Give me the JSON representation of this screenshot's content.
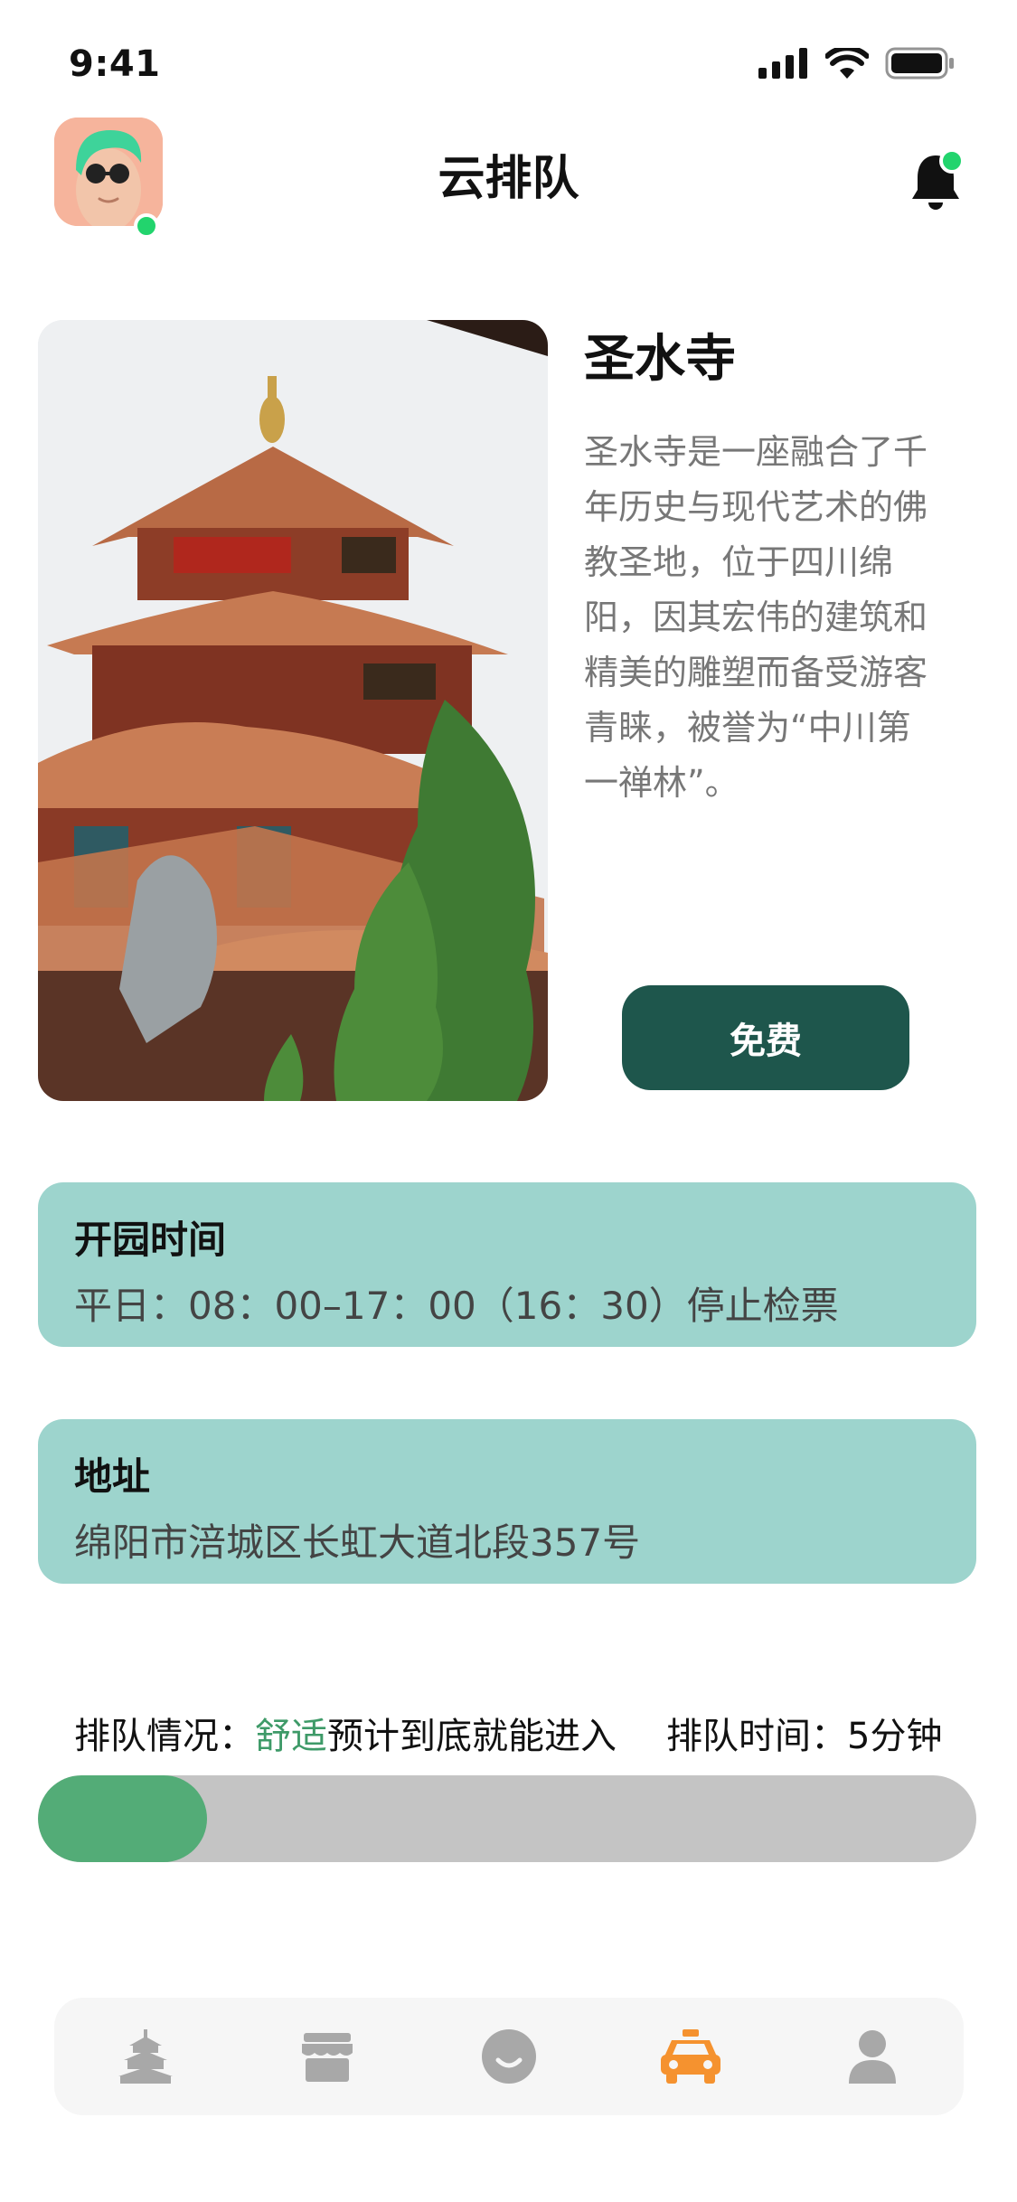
{
  "status_bar": {
    "time": "9:41",
    "signal_icon": "signal-icon",
    "wifi_icon": "wifi-icon",
    "battery_icon": "battery-icon"
  },
  "header": {
    "title": "云排队",
    "avatar_icon": "avatar",
    "online_dot_color": "#22d46d",
    "notification_icon": "bell-icon",
    "notification_dot_color": "#22d46d"
  },
  "attraction": {
    "name": "圣水寺",
    "description": "圣水寺是一座融合了千年历史与现代艺术的佛教圣地，位于四川绵阳，因其宏伟的建筑和精美的雕塑而备受游客青睐，被誉为“中川第一禅林”。",
    "price_label": "免费",
    "button_color": "#1e564c"
  },
  "hours": {
    "title": "开园时间",
    "value": "平日：08：00–17：00（16：30）停止检票"
  },
  "address": {
    "title": "地址",
    "value": "绵阳市涪城区长虹大道北段357号"
  },
  "queue": {
    "label": "排队情况：",
    "status": "舒适",
    "status_color": "#3e9a68",
    "note": "预计到底就能进入",
    "time_label": "排队时间：",
    "time_value": "5分钟",
    "progress_percent": 18
  },
  "bottom_nav": {
    "items": [
      {
        "icon": "temple-icon",
        "active": false
      },
      {
        "icon": "shop-icon",
        "active": false
      },
      {
        "icon": "smile-icon",
        "active": false
      },
      {
        "icon": "taxi-icon",
        "active": true
      },
      {
        "icon": "profile-icon",
        "active": false
      }
    ],
    "active_color": "#f5922f",
    "inactive_color": "#a8a8a8"
  }
}
